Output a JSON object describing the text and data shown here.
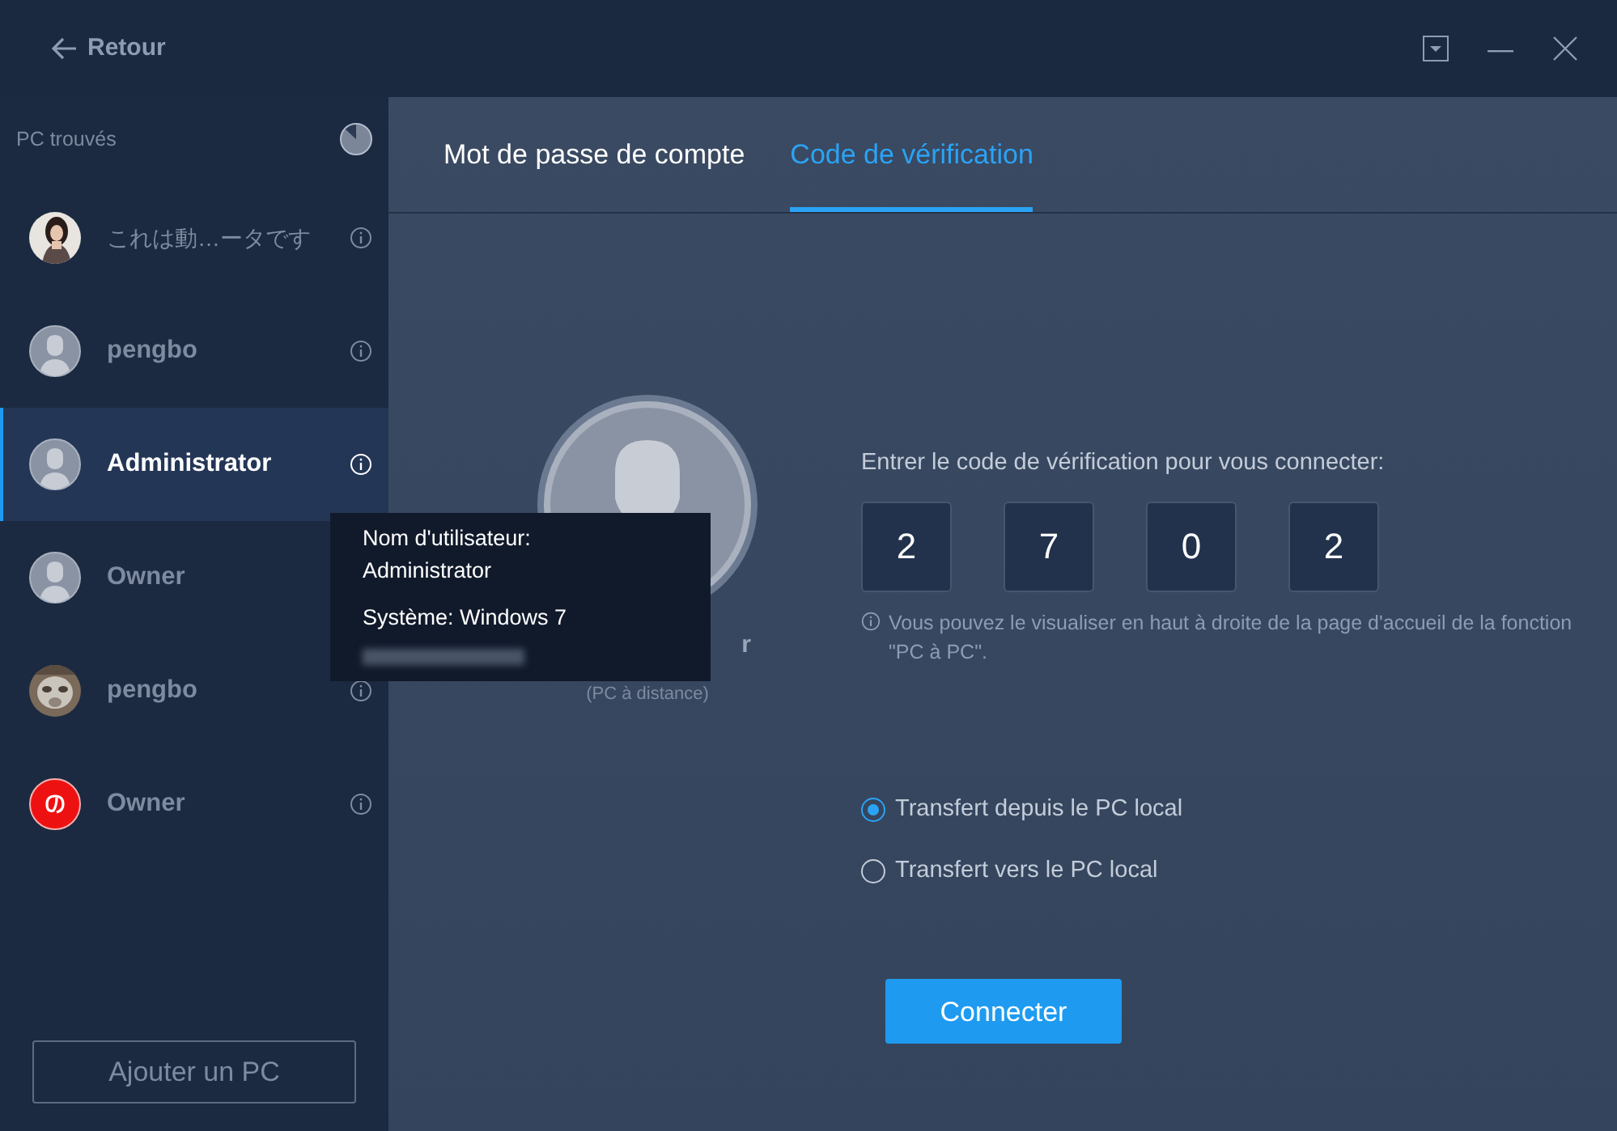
{
  "title_bar": {
    "back_label": "Retour"
  },
  "sidebar": {
    "heading": "PC trouvés",
    "items": [
      {
        "name": "これは動…ータです",
        "selected": false
      },
      {
        "name": "pengbo",
        "kind": "default",
        "selected": false
      },
      {
        "name": "Administrator",
        "kind": "default",
        "selected": true
      },
      {
        "name": "Owner",
        "kind": "default",
        "selected": false
      },
      {
        "name": "pengbo",
        "selected": false
      },
      {
        "name": "Owner",
        "kind": "logo",
        "selected": false
      }
    ],
    "add_button": "Ajouter un PC"
  },
  "tooltip": {
    "lines": [
      "Nom d'utilisateur:",
      "Administrator",
      "Système: Windows 7"
    ]
  },
  "tabs": [
    {
      "label": "Mot de passe de compte",
      "selected": false
    },
    {
      "label": "Code de vérification",
      "selected": true
    }
  ],
  "remote": {
    "name_visible": "r",
    "caption": "(PC à distance)"
  },
  "code": {
    "prompt": "Entrer le code de vérification pour vous connecter:",
    "digits": [
      "2",
      "7",
      "0",
      "2"
    ],
    "hint": "Vous pouvez le visualiser en haut à droite de la page d'accueil de la fonction \"PC à PC\"."
  },
  "options": [
    {
      "label": "Transfert depuis le PC local",
      "selected": true
    },
    {
      "label": "Transfert vers le PC local",
      "selected": false
    }
  ],
  "connect_button": "Connecter"
}
